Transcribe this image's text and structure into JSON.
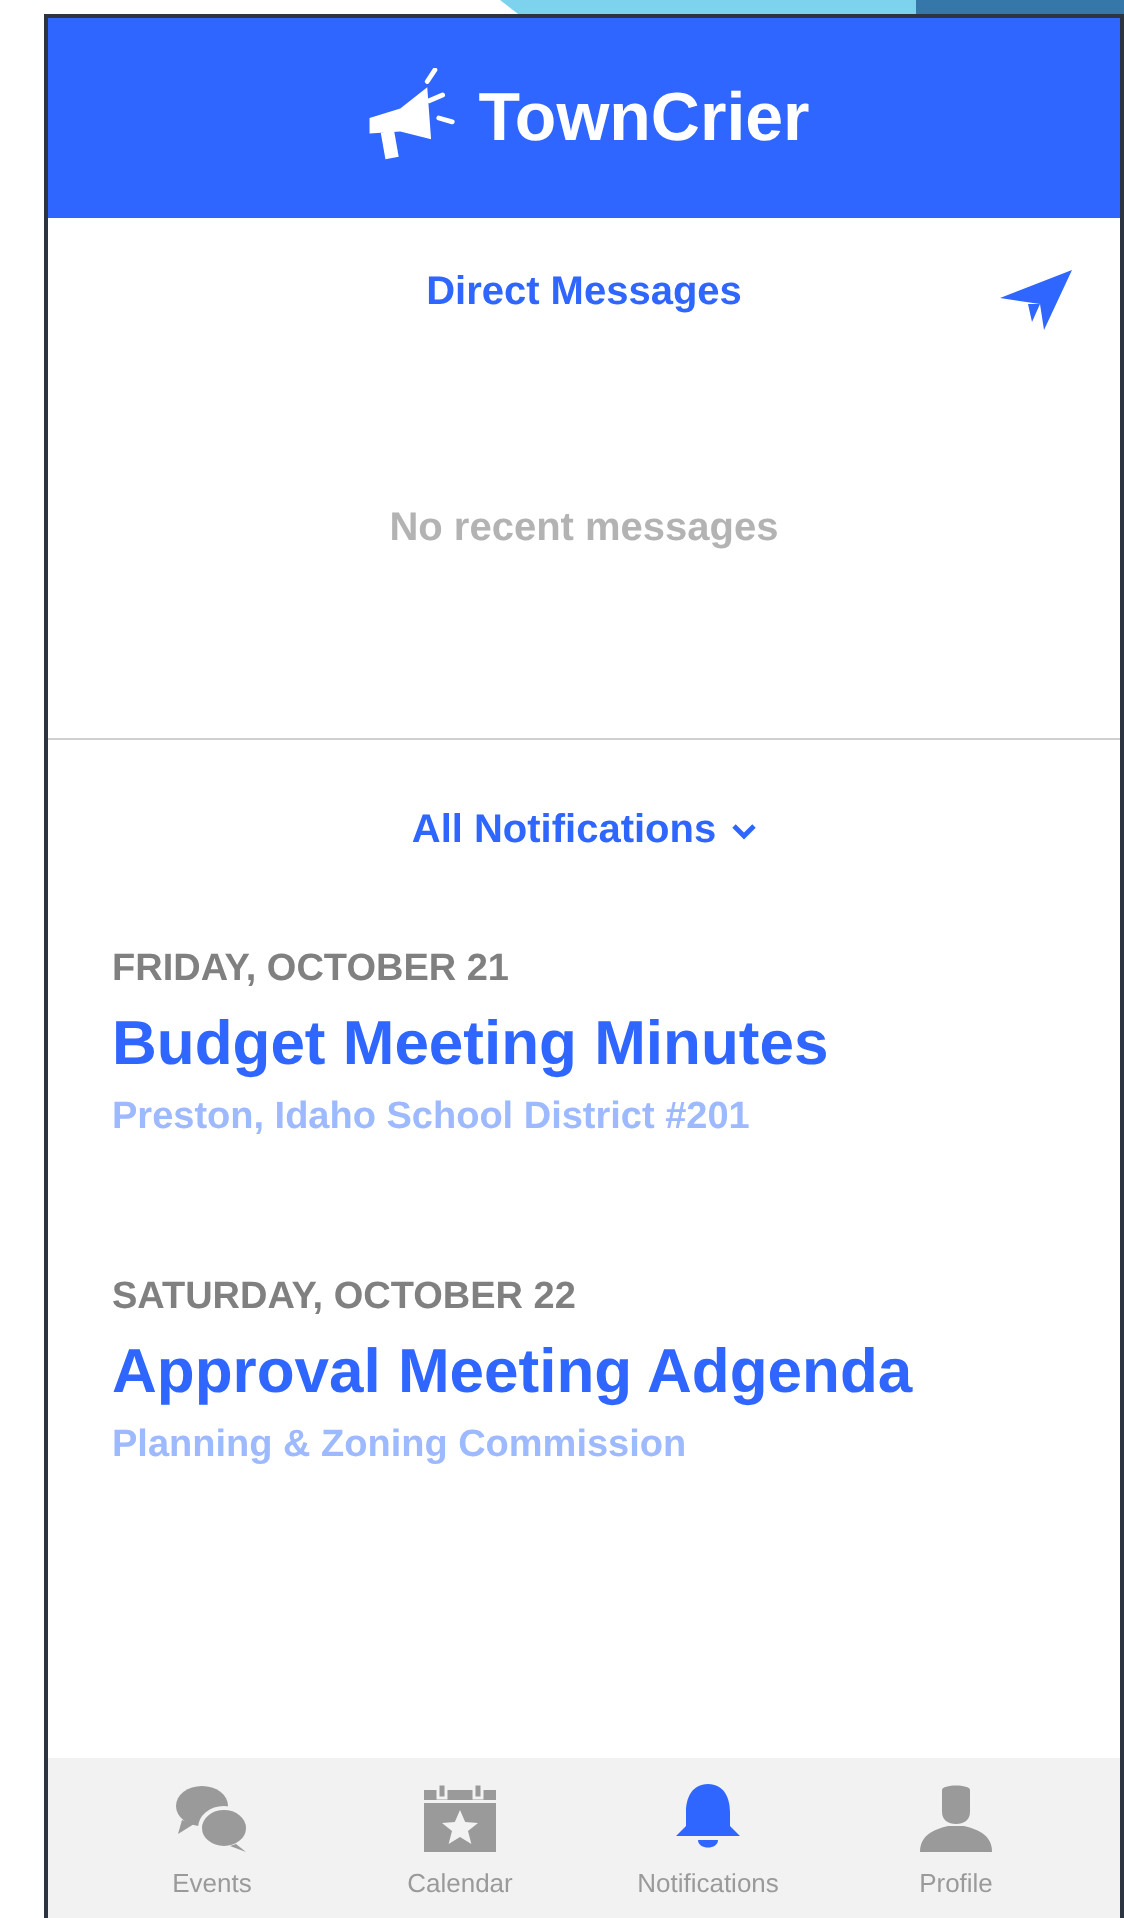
{
  "header": {
    "app_name": "TownCrier"
  },
  "direct_messages": {
    "title": "Direct Messages",
    "empty_text": "No recent messages"
  },
  "notifications": {
    "filter": "All Notifications",
    "items": [
      {
        "date": "FRIDAY, OCTOBER 21",
        "title": "Budget Meeting Minutes",
        "source": "Preston, Idaho School District #201"
      },
      {
        "date": "SATURDAY, OCTOBER 22",
        "title": "Approval Meeting Adgenda",
        "source": "Planning & Zoning Commission"
      }
    ]
  },
  "tabs": [
    {
      "kind": "events",
      "label": "Events",
      "selected": false
    },
    {
      "kind": "calendar",
      "label": "Calendar",
      "selected": false
    },
    {
      "kind": "notifications",
      "label": "Notifications",
      "selected": true
    },
    {
      "kind": "profile",
      "label": "Profile",
      "selected": false
    }
  ]
}
